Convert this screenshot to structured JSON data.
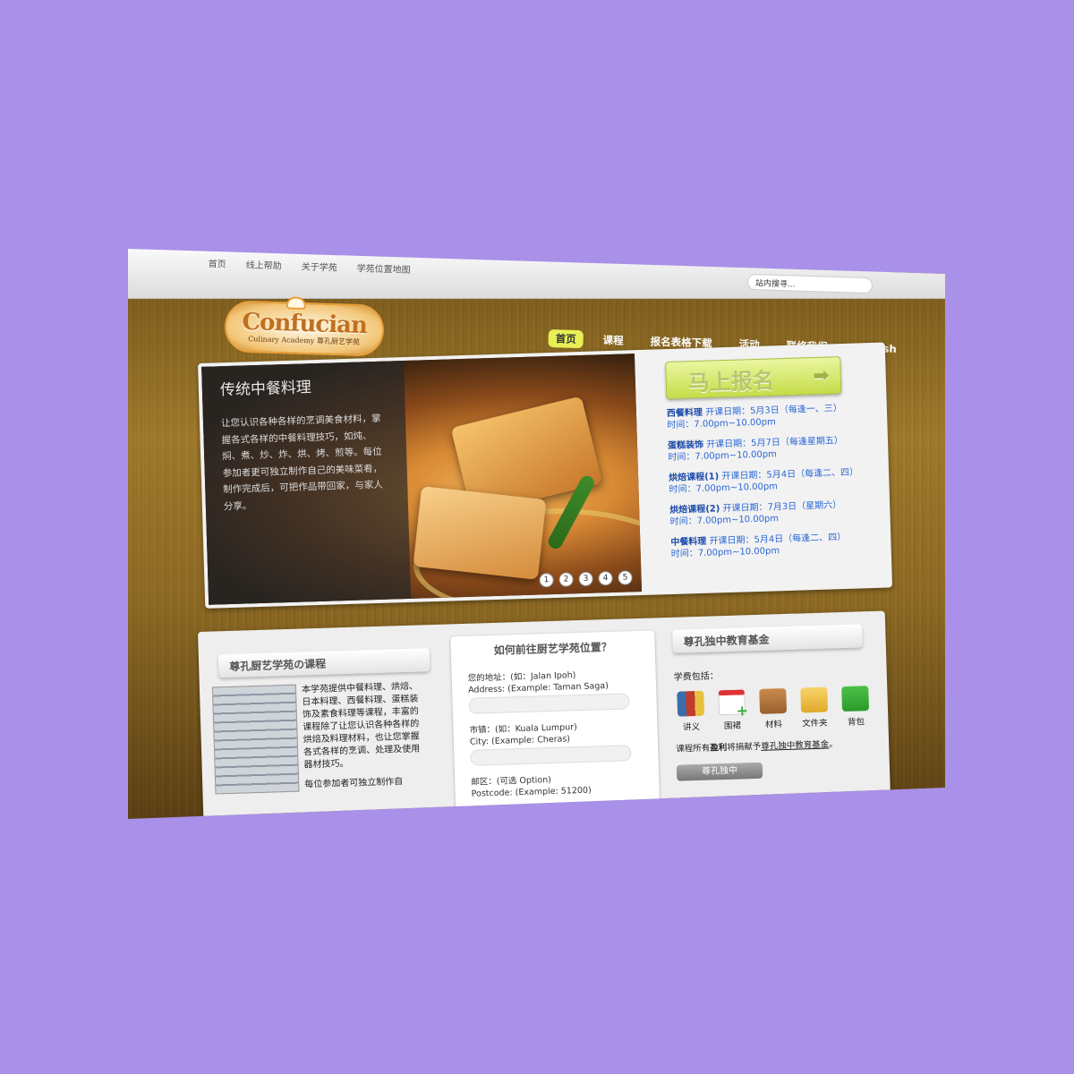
{
  "topbar": {
    "links": [
      "首页",
      "线上帮助",
      "关于学苑",
      "学苑位置地图"
    ],
    "search_placeholder": "站内搜寻..."
  },
  "logo": {
    "main": "Confucian",
    "sub": "Culinary Academy 尊孔厨艺学苑"
  },
  "mainnav": {
    "items": [
      "首页",
      "课程",
      "报名表格下载",
      "活动",
      "联络我们",
      "English"
    ],
    "active_index": 0
  },
  "hero": {
    "slide_title": "传统中餐料理",
    "slide_text": "让您认识各种各样的烹调美食材料，掌握各式各样的中餐料理技巧，如炖、焖、煮、炒、炸、烘、烤、煎等。每位参加者更可独立制作自己的美味菜肴，制作完成后，可把作品带回家，与家人分享。",
    "dots": [
      "1",
      "2",
      "3",
      "4",
      "5"
    ],
    "enroll_label": "马上报名",
    "courses": [
      {
        "name": "西餐料理",
        "date": "开课日期：5月3日（每逢一、三）",
        "time": "时间：7.00pm~10.00pm"
      },
      {
        "name": "蛋糕装饰",
        "date": "开课日期：5月7日（每逢星期五）",
        "time": "时间：7.00pm~10.00pm"
      },
      {
        "name": "烘焙课程(1)",
        "date": "开课日期：5月4日（每逢二、四）",
        "time": "时间：7.00pm~10.00pm"
      },
      {
        "name": "烘焙课程(2)",
        "date": "开课日期：7月3日（星期六）",
        "time": "时间：7.00pm~10.00pm"
      },
      {
        "name": "中餐料理",
        "date": "开课日期：5月4日（每逢二、四）",
        "time": "时间：7.00pm~10.00pm"
      }
    ]
  },
  "col1": {
    "title": "尊孔厨艺学苑の课程",
    "text": "本学苑提供中餐料理、烘焙、日本料理、西餐料理、蛋糕装饰及素食料理等课程，丰富的课程除了让您认识各种各样的烘焙及料理材料，也让您掌握各式各样的烹调、处理及使用器材技巧。",
    "text2": "每位参加者可独立制作自"
  },
  "form": {
    "title": "如何前往厨艺学苑位置？",
    "address_label": "您的地址：(如：Jalan Ipoh)",
    "address_hint": "Address: (Example: Taman Saga)",
    "city_label": "市镇：(如：Kuala Lumpur)",
    "city_hint": "City: (Example: Cheras)",
    "postcode_label": "邮区：(可选 Option)",
    "postcode_hint": "Postcode: (Example: 51200)"
  },
  "col3": {
    "title": "尊孔独中教育基金",
    "fees_label": "学费包括：",
    "icons": [
      {
        "name": "books-icon",
        "label": "讲义"
      },
      {
        "name": "calendar-add-icon",
        "label": "围裙"
      },
      {
        "name": "box-icon",
        "label": "材料"
      },
      {
        "name": "folder-icon",
        "label": "文件夹"
      },
      {
        "name": "bag-icon",
        "label": "背包"
      }
    ],
    "note_pre": "课程所有",
    "note_bold": "盈利",
    "note_mid": "将捐献予",
    "note_link": "尊孔独中教育基金",
    "note_end": "。",
    "button_label": "尊孔独中"
  }
}
